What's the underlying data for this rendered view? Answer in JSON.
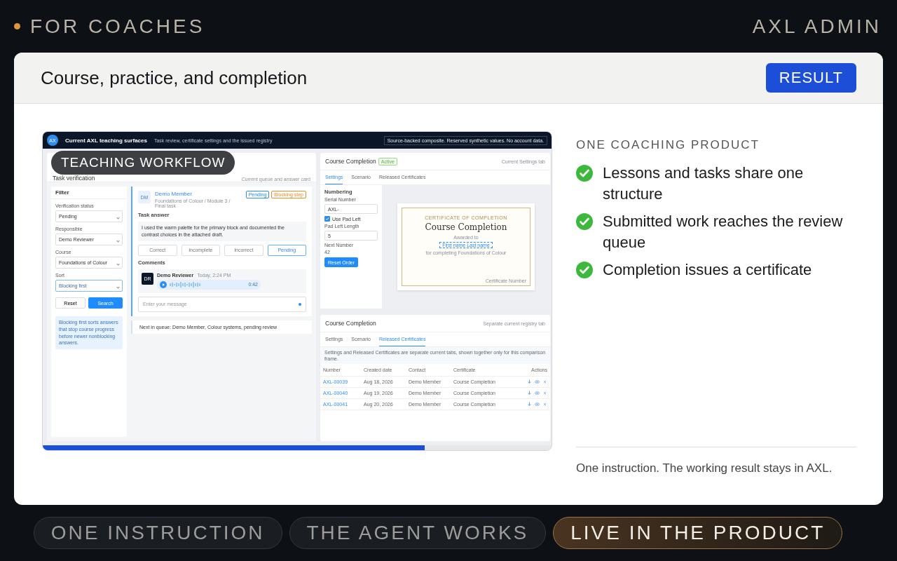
{
  "header": {
    "eyebrow": "FOR COACHES",
    "brand": "AXL ADMIN"
  },
  "card": {
    "title": "Course, practice, and completion",
    "result_button": "RESULT"
  },
  "preview": {
    "overlay_label": "TEACHING WORKFLOW",
    "topbar": {
      "logo": "AX",
      "title": "Current AXL teaching surfaces",
      "subtitle": "Task review, certificate settings and the issued registry",
      "notice": "Source-backed composite. Reserved synthetic values. No account data."
    },
    "task_panel": {
      "title": "Task verification",
      "note": "Current queue and answer card",
      "filter": {
        "title": "Filter",
        "fields": [
          {
            "label": "Verification status",
            "value": "Pending",
            "focused": false
          },
          {
            "label": "Responsible",
            "value": "Demo Reviewer",
            "focused": false
          },
          {
            "label": "Course",
            "value": "Foundations of Colour",
            "focused": false
          },
          {
            "label": "Sort",
            "value": "Blocking first",
            "focused": true
          }
        ],
        "reset": "Reset",
        "search": "Search",
        "hint": "Blocking first sorts answers that stop course progress before newer nonblocking answers."
      },
      "answer": {
        "avatar": "DM",
        "name": "Demo Member",
        "path": "Foundations of Colour / Module 3 / Final task",
        "badges": [
          {
            "label": "Pending",
            "color": "#2f8cf0"
          },
          {
            "label": "Blocking step",
            "color": "#e8901e"
          }
        ],
        "answer_title": "Task answer",
        "answer_text": "I used the warm palette for the primary block and documented the contrast choices in the attached draft.",
        "verdicts": [
          {
            "label": "Correct",
            "selected": false
          },
          {
            "label": "Incomplete",
            "selected": false
          },
          {
            "label": "Incorrect",
            "selected": false
          },
          {
            "label": "Pending",
            "selected": true
          }
        ],
        "comments_title": "Comments",
        "comment": {
          "avatar": "DR",
          "author": "Demo Reviewer",
          "time": "Today, 2:24 PM",
          "duration": "0:42"
        },
        "message_placeholder": "Enter your message"
      },
      "next": "Next in queue: Demo Member, Colour systems, pending review"
    },
    "settings_card": {
      "title": "Course Completion",
      "status": "Active",
      "note": "Current Settings tab",
      "tabs": [
        {
          "label": "Settings",
          "selected": true
        },
        {
          "label": "Scenario",
          "selected": false
        },
        {
          "label": "Released Certificates",
          "selected": false
        }
      ],
      "section": "Numbering",
      "serial_label": "Serial Number",
      "serial_value": "AXL-",
      "pad_checkbox": {
        "label": "Use Pad Left",
        "checked": true
      },
      "pad_length_label": "Pad Left Length",
      "pad_length_value": "5",
      "next_label": "Next Number",
      "next_value": "42",
      "reset_order": "Reset Order",
      "certificate": {
        "eyebrow": "CERTIFICATE OF COMPLETION",
        "title": "Course Completion",
        "awarded": "Awarded to",
        "name": "First name Last name",
        "for": "for completing Foundations of Colour",
        "footer": "Certificate Number"
      }
    },
    "registry_card": {
      "title": "Course Completion",
      "note": "Separate current registry tab",
      "tabs": [
        {
          "label": "Settings",
          "selected": false
        },
        {
          "label": "Scenario",
          "selected": false
        },
        {
          "label": "Released Certificates",
          "selected": true
        }
      ],
      "notice": "Settings and Released Certificates are separate current tabs, shown together only for this comparison frame.",
      "columns": [
        "Number",
        "Created date",
        "Contact",
        "Certificate",
        "Actions"
      ],
      "rows": [
        {
          "number": "AXL-00039",
          "date": "Aug 18, 2026",
          "contact": "Demo Member",
          "certificate": "Course Completion"
        },
        {
          "number": "AXL-00040",
          "date": "Aug 19, 2026",
          "contact": "Demo Member",
          "certificate": "Course Completion"
        },
        {
          "number": "AXL-00041",
          "date": "Aug 20, 2026",
          "contact": "Demo Member",
          "certificate": "Course Completion"
        }
      ]
    },
    "progress": {
      "level": 0.75
    }
  },
  "summary": {
    "eyebrow": "ONE COACHING PRODUCT",
    "points": [
      "Lessons and tasks share one structure",
      "Submitted work reaches the review queue",
      "Completion issues a certificate"
    ],
    "footnote": "One instruction. The working result stays in AXL."
  },
  "steps": [
    {
      "label": "ONE INSTRUCTION",
      "selected": false
    },
    {
      "label": "THE AGENT WORKS",
      "selected": false
    },
    {
      "label": "LIVE IN THE PRODUCT",
      "selected": true
    }
  ]
}
